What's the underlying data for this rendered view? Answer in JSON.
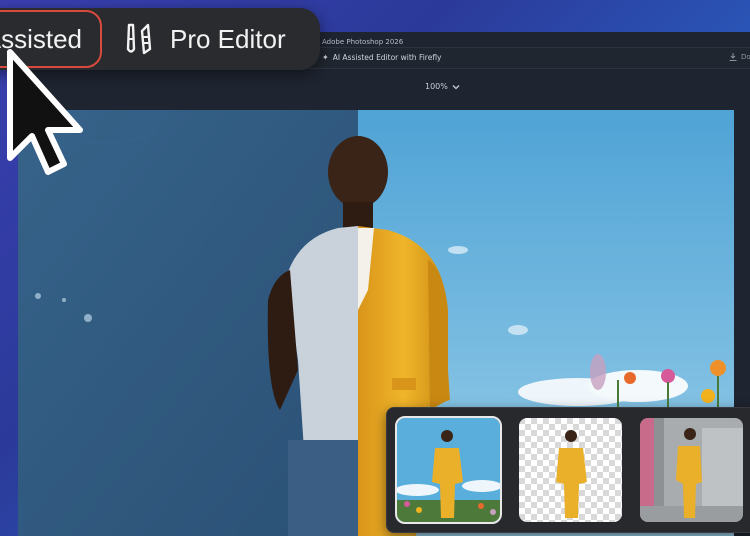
{
  "app": {
    "title": "Adobe Photoshop 2026",
    "mode_label": "AI Assisted Editor with Firefly",
    "download_label": "Do",
    "zoom": "100%"
  },
  "mode_switch": {
    "assisted_label": "Assisted",
    "pro_label": "Pro Editor",
    "active": "assisted"
  },
  "icons": {
    "sparkle": "sparkle-icon",
    "zoom_dropdown": "chevron-down-icon",
    "pro_editor": "brush-pencil-icon",
    "cursor": "arrow-cursor-icon",
    "download": "download-icon"
  },
  "variations": {
    "items": [
      {
        "name": "original-background",
        "selected": true
      },
      {
        "name": "background-removed",
        "selected": false
      },
      {
        "name": "concrete-room-background",
        "selected": false
      }
    ]
  },
  "colors": {
    "accent_border": "#d84a3d",
    "suit": "#e8a81e",
    "sky": "#6fb8dc",
    "wall_overlay": "#3f6f95"
  }
}
